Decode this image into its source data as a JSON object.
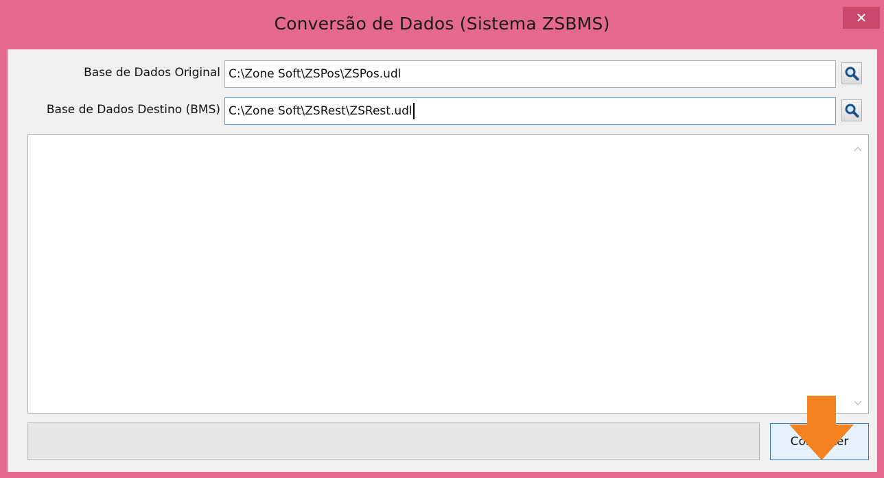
{
  "window": {
    "title": "Conversão de Dados (Sistema ZSBMS)",
    "close_glyph": "✕",
    "title_bar_color": "#e5698f"
  },
  "form": {
    "original_label": "Base de Dados Original",
    "original_value": "C:\\Zone Soft\\ZSPos\\ZSPos.udl",
    "destination_label": "Base de Dados Destino (BMS)",
    "destination_value": "C:\\Zone Soft\\ZSRest\\ZSRest.udl"
  },
  "actions": {
    "convert_label": "Converter"
  },
  "icons": {
    "browse": "search-icon",
    "annotation": "arrow-down-icon",
    "annotation_color": "#f58220"
  }
}
